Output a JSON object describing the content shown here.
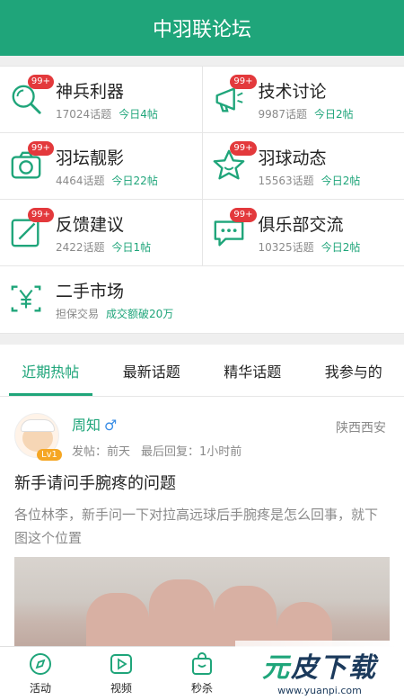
{
  "header": {
    "title": "中羽联论坛"
  },
  "forums": [
    {
      "title": "神兵利器",
      "topics": "17024话题",
      "today": "今日4帖",
      "badge": "99+",
      "icon": "search-magnifier-icon"
    },
    {
      "title": "技术讨论",
      "topics": "9987话题",
      "today": "今日2帖",
      "badge": "99+",
      "icon": "megaphone-icon"
    },
    {
      "title": "羽坛靓影",
      "topics": "4464话题",
      "today": "今日22帖",
      "badge": "99+",
      "icon": "camera-icon"
    },
    {
      "title": "羽球动态",
      "topics": "15563话题",
      "today": "今日2帖",
      "badge": "99+",
      "icon": "star-face-icon"
    },
    {
      "title": "反馈建议",
      "topics": "2422话题",
      "today": "今日1帖",
      "badge": "99+",
      "icon": "edit-icon"
    },
    {
      "title": "俱乐部交流",
      "topics": "10325话题",
      "today": "今日2帖",
      "badge": "99+",
      "icon": "chat-icon"
    },
    {
      "title": "二手市场",
      "topics": "担保交易",
      "today": "成交额破20万",
      "badge": "",
      "icon": "yen-icon"
    }
  ],
  "tabs": [
    "近期热帖",
    "最新话题",
    "精华话题",
    "我参与的"
  ],
  "post": {
    "author": "周知",
    "gender": "♂",
    "level": "Lv1",
    "location": "陕西西安",
    "posted": "发帖：前天",
    "last_reply": "最后回复：1小时前",
    "title": "新手请问手腕疼的问题",
    "body": "各位林李，新手问一下对拉高远球后手腕疼是怎么回事，就下图这个位置"
  },
  "bottom_nav": [
    {
      "label": "活动",
      "icon": "compass-icon"
    },
    {
      "label": "视频",
      "icon": "play-icon"
    },
    {
      "label": "秒杀",
      "icon": "shopping-bag-icon"
    }
  ],
  "watermark": {
    "title_a": "元",
    "title_b": "皮下载",
    "url": "www.yuanpi.com"
  },
  "colors": {
    "brand": "#1fa57a",
    "badge": "#e3393c",
    "accent_blue": "#3a8ee6"
  }
}
